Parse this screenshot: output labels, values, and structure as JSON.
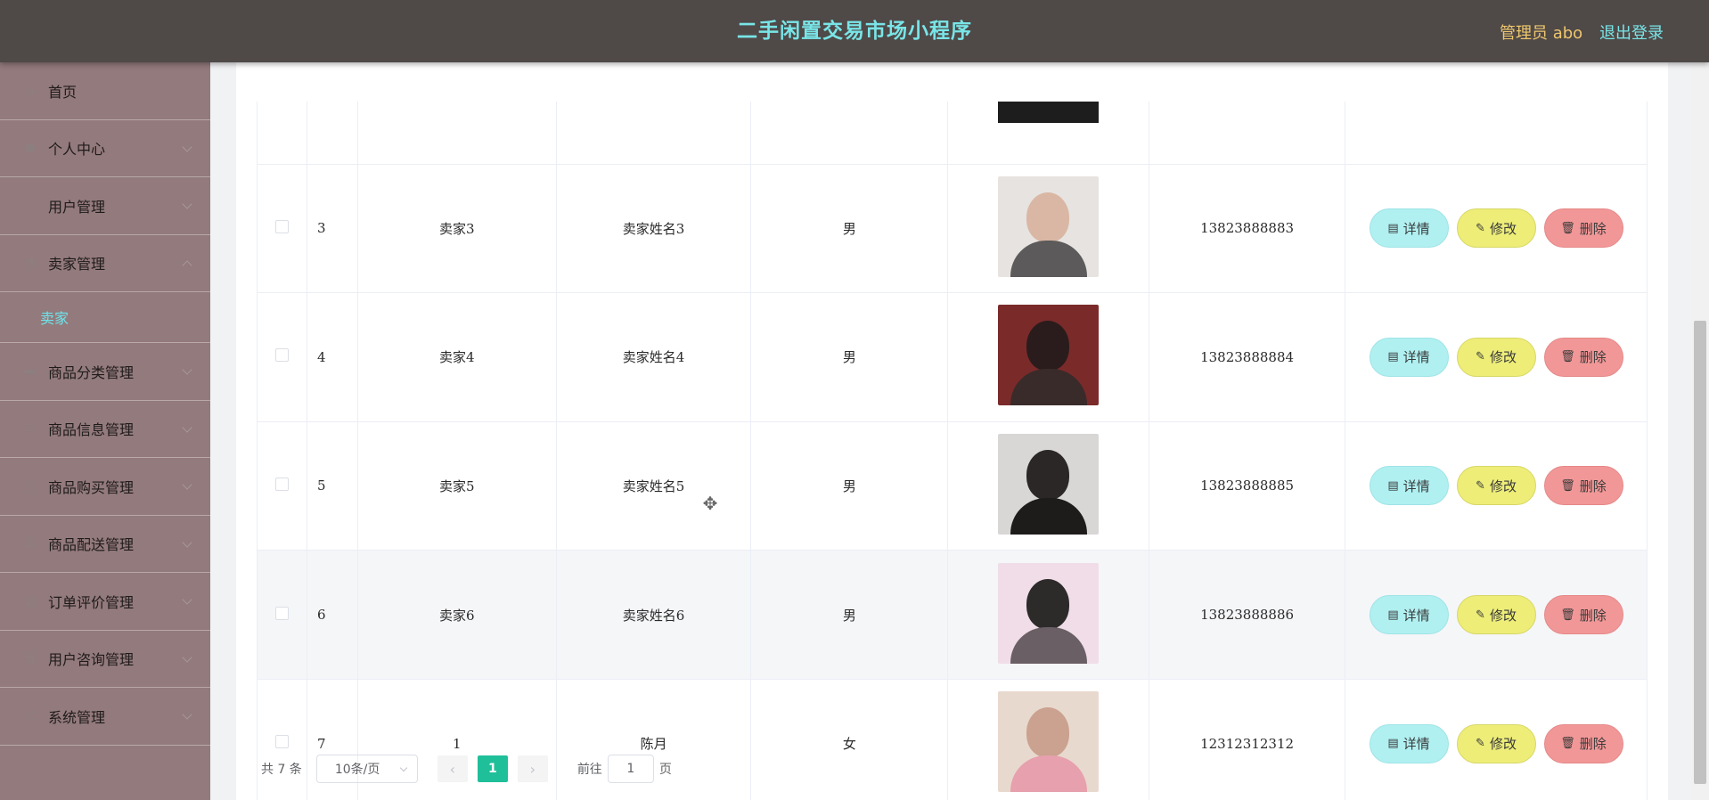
{
  "header": {
    "title": "二手闲置交易市场小程序",
    "admin_label": "管理员 abo",
    "logout_label": "退出登录"
  },
  "sidebar": {
    "items": [
      {
        "label": "首页",
        "icon": "home-icon"
      },
      {
        "label": "个人中心",
        "icon": "user-icon"
      },
      {
        "label": "用户管理",
        "icon": "users-icon"
      },
      {
        "label": "卖家管理",
        "icon": "seller-icon",
        "expanded": true,
        "sub": [
          "卖家"
        ]
      },
      {
        "label": "商品分类管理",
        "icon": "category-icon"
      },
      {
        "label": "商品信息管理",
        "icon": "goods-icon"
      },
      {
        "label": "商品购买管理",
        "icon": "purchase-icon"
      },
      {
        "label": "商品配送管理",
        "icon": "delivery-icon"
      },
      {
        "label": "订单评价管理",
        "icon": "review-icon"
      },
      {
        "label": "用户咨询管理",
        "icon": "consult-icon"
      },
      {
        "label": "系统管理",
        "icon": "system-icon"
      }
    ]
  },
  "table": {
    "rows": [
      {
        "idx": "3",
        "account": "卖家3",
        "name": "卖家姓名3",
        "sex": "男",
        "phone": "13823888883"
      },
      {
        "idx": "4",
        "account": "卖家4",
        "name": "卖家姓名4",
        "sex": "男",
        "phone": "13823888884"
      },
      {
        "idx": "5",
        "account": "卖家5",
        "name": "卖家姓名5",
        "sex": "男",
        "phone": "13823888885"
      },
      {
        "idx": "6",
        "account": "卖家6",
        "name": "卖家姓名6",
        "sex": "男",
        "phone": "13823888886"
      },
      {
        "idx": "7",
        "account": "1",
        "name": "陈月",
        "sex": "女",
        "phone": "12312312312"
      }
    ],
    "actions": {
      "detail": "详情",
      "edit": "修改",
      "delete": "删除"
    }
  },
  "pagination": {
    "total": "共 7 条",
    "page_size": "10条/页",
    "current_page": "1",
    "goto_label": "前往",
    "goto_value": "1",
    "page_unit": "页"
  },
  "colors": {
    "header_bg": "#4f4948",
    "title": "#79e5e7",
    "sidebar_bg": "#937a7c",
    "active_sub": "#6ee3ea",
    "detail_btn": "#b0f0f1",
    "edit_btn": "#eded78",
    "delete_btn": "#f29797",
    "pager_active": "#1fbf9a"
  }
}
